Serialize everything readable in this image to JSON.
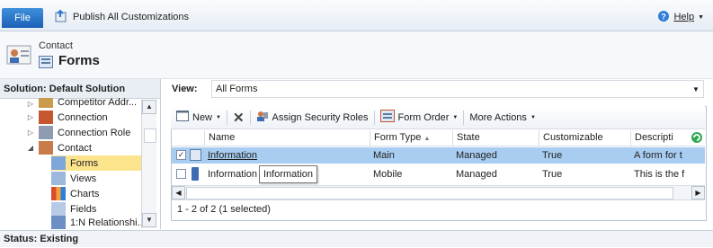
{
  "ribbon": {
    "file_label": "File",
    "publish_label": "Publish All Customizations",
    "help_label": "Help"
  },
  "header": {
    "entity_label": "Contact",
    "title": "Forms"
  },
  "solution": {
    "title": "Solution: Default Solution",
    "tree": [
      {
        "label": "Competitor Addr...",
        "icon": "address-icon",
        "expand": "collapsed"
      },
      {
        "label": "Connection",
        "icon": "connection-icon",
        "expand": "collapsed"
      },
      {
        "label": "Connection Role",
        "icon": "connection-role-icon",
        "expand": "collapsed"
      },
      {
        "label": "Contact",
        "icon": "contact-icon",
        "expand": "expanded"
      },
      {
        "label": "Forms",
        "icon": "forms-icon",
        "selected": true
      },
      {
        "label": "Views",
        "icon": "views-icon"
      },
      {
        "label": "Charts",
        "icon": "charts-icon"
      },
      {
        "label": "Fields",
        "icon": "fields-icon"
      },
      {
        "label": "1:N Relationshi...",
        "icon": "relationship-icon"
      }
    ]
  },
  "status": "Status: Existing",
  "view": {
    "label": "View:",
    "value": "All Forms"
  },
  "toolbar": {
    "new_label": "New",
    "assign_label": "Assign Security Roles",
    "form_order_label": "Form Order",
    "more_actions_label": "More Actions"
  },
  "grid": {
    "columns": [
      "Name",
      "Form Type",
      "State",
      "Customizable",
      "Descripti"
    ],
    "rows": [
      {
        "name": "Information",
        "form_type": "Main",
        "state": "Managed",
        "customizable": "True",
        "description": "A form for t",
        "checked": true,
        "selected": true
      },
      {
        "name": "Information",
        "form_type": "Mobile",
        "state": "Managed",
        "customizable": "True",
        "description": "This is the f",
        "checked": false,
        "selected": false
      }
    ],
    "tooltip": "Information",
    "footer": "1 - 2 of 2 (1 selected)"
  },
  "colors": {
    "accent": "#1b60b8",
    "selection": "#a8cdf1",
    "tree_selection": "#fce48d"
  }
}
